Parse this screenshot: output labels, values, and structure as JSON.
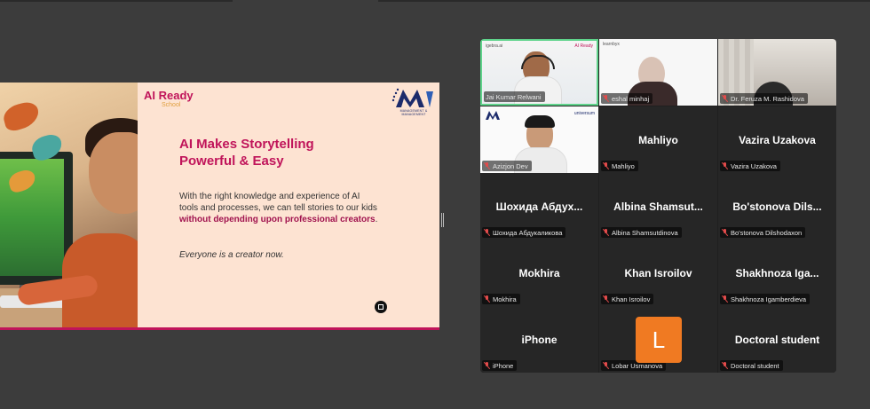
{
  "slide": {
    "logo_main": "AI Ready",
    "logo_sub": "School",
    "logo_m_caption": "MANAGEMENT & MANAGEMENT",
    "title_line1": "AI Makes Storytelling",
    "title_line2": "Powerful & Easy",
    "body_text": "With the right knowledge and experience of AI tools and processes, we can tell stories to our kids ",
    "body_bold": "without depending upon professional creators",
    "body_end": ".",
    "note": "Everyone is a creator now."
  },
  "gallery": {
    "tiles": [
      {
        "display": "",
        "tag": "Jai Kumar Relwani",
        "video": true
      },
      {
        "display": "",
        "tag": "eshal minhaj",
        "video": true
      },
      {
        "display": "",
        "tag": "Dr. Feruza M. Rashidova",
        "video": true
      },
      {
        "display": "",
        "tag": "Azizjon Dev",
        "video": true
      },
      {
        "display": "Mahliyo",
        "tag": "Mahliyo",
        "video": false
      },
      {
        "display": "Vazira Uzakova",
        "tag": "Vazira Uzakova",
        "video": false
      },
      {
        "display": "Шохида Абдух...",
        "tag": "Шохида Абдукаликова",
        "video": false
      },
      {
        "display": "Albina Shamsut...",
        "tag": "Albina Shamsutdinova",
        "video": false
      },
      {
        "display": "Bo'stonova Dils...",
        "tag": "Bo'stonova Dilshodaxon",
        "video": false
      },
      {
        "display": "Mokhira",
        "tag": "Mokhira",
        "video": false
      },
      {
        "display": "Khan Isroilov",
        "tag": "Khan Isroilov",
        "video": false
      },
      {
        "display": "Shakhnoza Iga...",
        "tag": "Shakhnoza Igamberdieva",
        "video": false
      },
      {
        "display": "iPhone",
        "tag": "iPhone",
        "video": false
      },
      {
        "display": "",
        "tag": "Lobar Usmanova",
        "video": false
      },
      {
        "display": "Doctoral student",
        "tag": "Doctoral student",
        "video": false
      }
    ],
    "avatar_letter": "L",
    "tile_logos": {
      "jai_left": "igebra.ai",
      "jai_right": "AI Ready",
      "eshal": "learnbyx",
      "aziz_right": "universum"
    },
    "colors": {
      "speaking_border": "#5fd38b",
      "muted_icon": "#e34b4b",
      "avatar_bg": "#f07a22"
    }
  }
}
